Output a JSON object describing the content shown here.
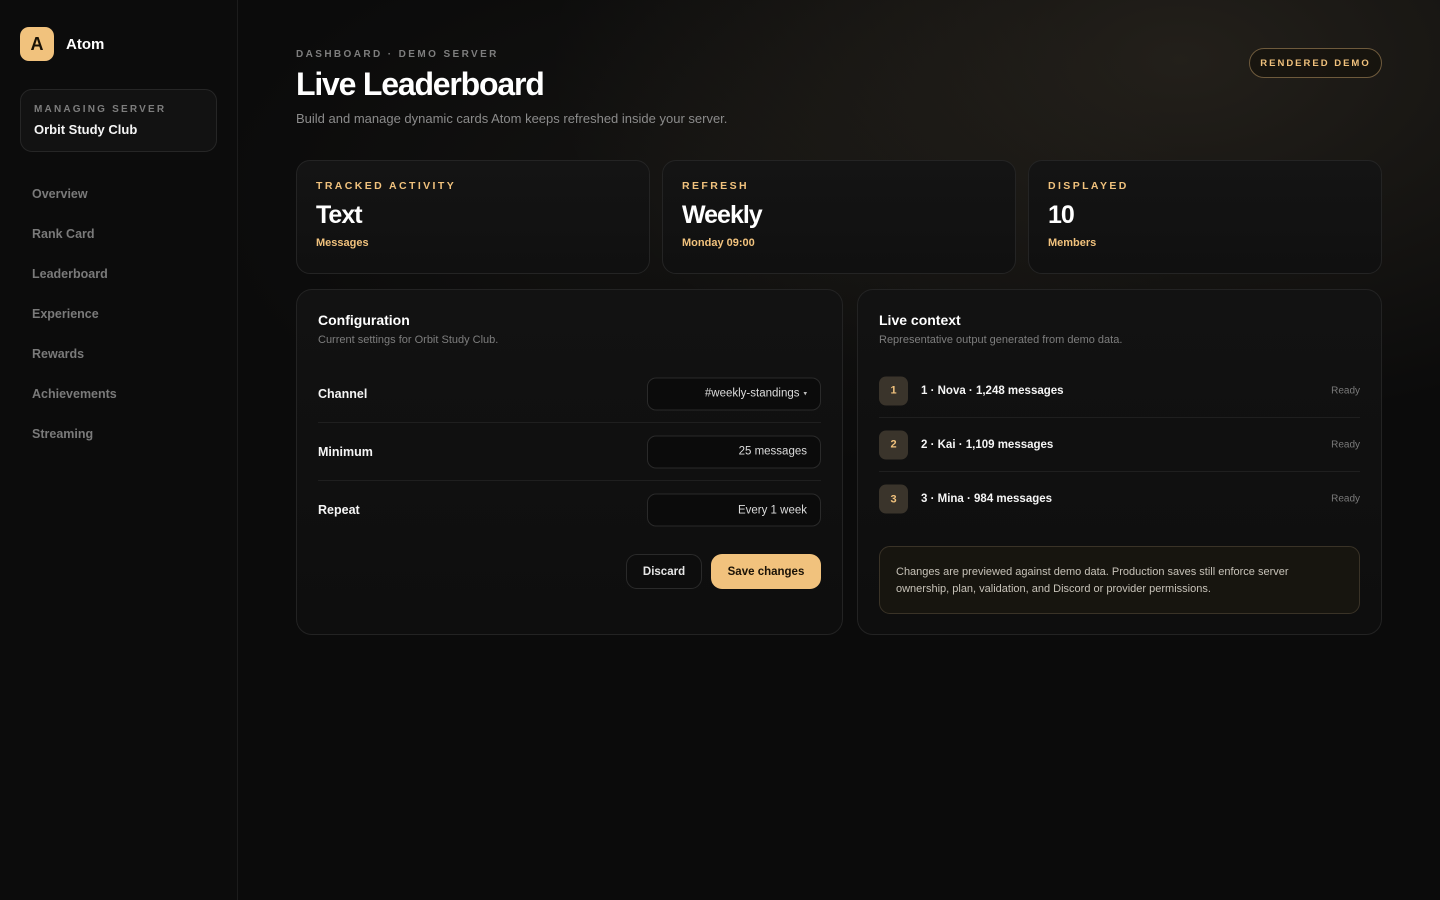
{
  "colors": {
    "accent": "#f1c27d",
    "background": "#0b0b0b",
    "panel": "#121212"
  },
  "brand": {
    "logo_letter": "A",
    "name": "Atom"
  },
  "server": {
    "label": "MANAGING SERVER",
    "name": "Orbit Study Club"
  },
  "nav": [
    {
      "label": "Overview"
    },
    {
      "label": "Rank Card"
    },
    {
      "label": "Leaderboard"
    },
    {
      "label": "Experience"
    },
    {
      "label": "Rewards"
    },
    {
      "label": "Achievements"
    },
    {
      "label": "Streaming"
    }
  ],
  "header": {
    "breadcrumb": "DASHBOARD · DEMO SERVER",
    "title": "Live Leaderboard",
    "subtitle": "Build and manage dynamic cards Atom keeps refreshed inside your server.",
    "badge": "RENDERED DEMO"
  },
  "stats": [
    {
      "label": "TRACKED ACTIVITY",
      "value": "Text",
      "sub": "Messages"
    },
    {
      "label": "REFRESH",
      "value": "Weekly",
      "sub": "Monday 09:00"
    },
    {
      "label": "DISPLAYED",
      "value": "10",
      "sub": "Members"
    }
  ],
  "configuration": {
    "title": "Configuration",
    "subtitle": "Current settings for Orbit Study Club.",
    "rows": [
      {
        "label": "Channel",
        "value": "#weekly-standings",
        "caret": "▾"
      },
      {
        "label": "Minimum",
        "value": "25 messages"
      },
      {
        "label": "Repeat",
        "value": "Every 1 week"
      }
    ],
    "discard_label": "Discard",
    "save_label": "Save changes"
  },
  "live_context": {
    "title": "Live context",
    "subtitle": "Representative output generated from demo data.",
    "entries": [
      {
        "rank": "1",
        "text": "1 · Nova · 1,248 messages",
        "status": "Ready"
      },
      {
        "rank": "2",
        "text": "2 · Kai · 1,109 messages",
        "status": "Ready"
      },
      {
        "rank": "3",
        "text": "3 · Mina · 984 messages",
        "status": "Ready"
      }
    ],
    "notice": "Changes are previewed against demo data. Production saves still enforce server ownership, plan, validation, and Discord or provider permissions."
  }
}
